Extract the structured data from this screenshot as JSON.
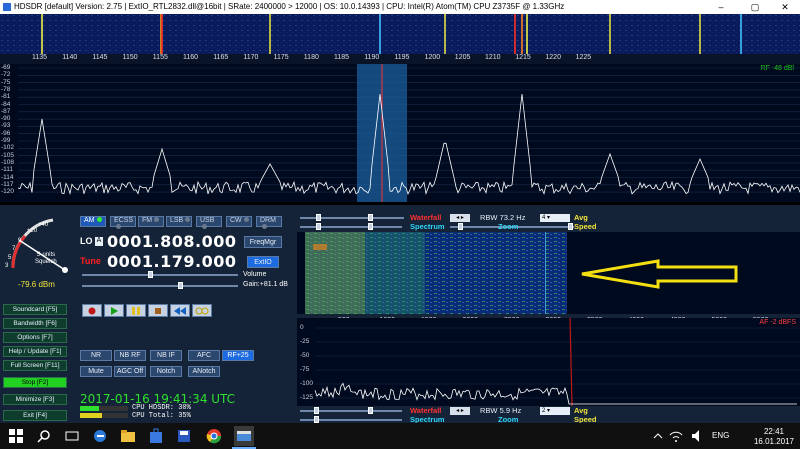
{
  "window": {
    "title": "HDSDR  [default]  Version: 2.75   |   ExtIO_RTL2832.dll@16bit   |  SRate: 2400000 > 12000   |  OS: 10.0.14393   |  CPU: Intel(R) Atom(TM) CPU  Z3735F @ 1.33GHz",
    "minimize": "–",
    "maximize": "▢",
    "close": "✕"
  },
  "spectrum": {
    "freq_labels": [
      "1135",
      "1140",
      "1145",
      "1150",
      "1155",
      "1160",
      "1165",
      "1170",
      "1175",
      "1180",
      "1185",
      "1190",
      "1195",
      "1200",
      "1205",
      "1210",
      "1215",
      "1220",
      "1225"
    ],
    "db_labels": [
      "-69",
      "-72",
      "-75",
      "-78",
      "-81",
      "-84",
      "-87",
      "-90",
      "-93",
      "-96",
      "-99",
      "-102",
      "-105",
      "-108",
      "-111",
      "-114",
      "-117",
      "-120"
    ],
    "rf_level": "RF -48 dBl"
  },
  "modes": [
    "AM",
    "ECSS",
    "FM",
    "LSB",
    "USB",
    "CW",
    "DRM"
  ],
  "lo": {
    "label": "LO",
    "a": "A",
    "value": "0001.808.000"
  },
  "tune": {
    "label": "Tune",
    "value": "0001.179.000"
  },
  "buttons": {
    "freqmgr": "FreqMgr",
    "extio": "ExtIO"
  },
  "volume": {
    "label": "Volume",
    "gain": "Gain:+81.1 dB"
  },
  "smeter": {
    "text": "S-units\nSquelch",
    "dbm": "-79.6 dBm",
    "scale": [
      "1",
      "3",
      "5",
      "7",
      "9",
      "+20",
      "+40"
    ]
  },
  "side_buttons": [
    "Soundcard  [F5]",
    "Bandwidth  [F6]",
    "Options   [F7]",
    "Help / Update  [F1]",
    "Full Screen  [F11]",
    "Stop      [F2]",
    "Minimize  [F3]",
    "Exit      [F4]"
  ],
  "dsp_row1": [
    "NR",
    "NB RF",
    "NB IF",
    "AFC",
    "RF+25"
  ],
  "dsp_row2": [
    "Mute",
    "AGC Off",
    "Notch",
    "ANotch"
  ],
  "datetime": "2017-01-16   19:41:34 UTC",
  "cpu": {
    "hdsdr": "CPU HDSDR:  30%",
    "total": "CPU Total:  35%"
  },
  "wf_controls": {
    "waterfall": "Waterfall",
    "spectrum": "Spectrum",
    "zoom": "Zoom",
    "speed": "Speed",
    "avg": "Avg"
  },
  "rbw_top": {
    "label": "RBW",
    "value": "73.2 Hz",
    "avg": "4"
  },
  "rbw_bottom": {
    "label": "RBW",
    "value": "5.9 Hz",
    "avg": "2"
  },
  "af": {
    "freq_labels": [
      "500",
      "1000",
      "1500",
      "2000",
      "2500",
      "3000",
      "3500",
      "4000",
      "4500",
      "5000",
      "5500"
    ],
    "db_labels": [
      "0",
      "-25",
      "-50",
      "-75",
      "-100",
      "-125"
    ],
    "level": "AF -2 dBFS"
  },
  "taskbar": {
    "lang": "ENG",
    "time": "22:41",
    "date": "16.01.2017"
  }
}
